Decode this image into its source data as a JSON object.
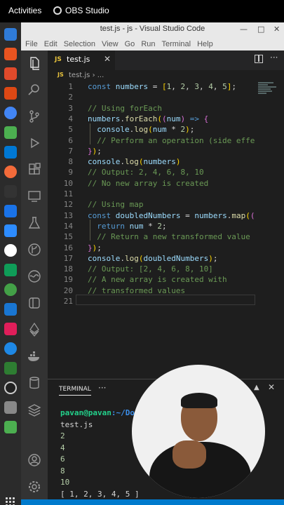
{
  "system": {
    "activities": "Activities",
    "app_name": "OBS Studio"
  },
  "window": {
    "title": "test.js - js - Visual Studio Code",
    "minimize": "—",
    "maximize": "□",
    "close": "✕"
  },
  "menu": [
    "File",
    "Edit",
    "Selection",
    "View",
    "Go",
    "Run",
    "Terminal",
    "Help"
  ],
  "tab": {
    "icon_label": "JS",
    "name": "test.js",
    "close": "✕"
  },
  "breadcrumb": {
    "icon_label": "JS",
    "file": "test.js",
    "sep": "› ..."
  },
  "editor": {
    "lines": [
      {
        "n": "1",
        "t": "const numbers = [1, 2, 3, 4, 5];"
      },
      {
        "n": "2",
        "t": ""
      },
      {
        "n": "3",
        "t": "// Using forEach"
      },
      {
        "n": "4",
        "t": "numbers.forEach((num) => {"
      },
      {
        "n": "5",
        "t": "  console.log(num * 2);"
      },
      {
        "n": "6",
        "t": "  // Perform an operation (side effe"
      },
      {
        "n": "7",
        "t": "});"
      },
      {
        "n": "8",
        "t": "console.log(numbers)"
      },
      {
        "n": "9",
        "t": "// Output: 2, 4, 6, 8, 10"
      },
      {
        "n": "10",
        "t": "// No new array is created"
      },
      {
        "n": "11",
        "t": ""
      },
      {
        "n": "12",
        "t": "// Using map"
      },
      {
        "n": "13",
        "t": "const doubledNumbers = numbers.map(("
      },
      {
        "n": "14",
        "t": "  return num * 2;"
      },
      {
        "n": "15",
        "t": "  // Return a new transformed value"
      },
      {
        "n": "16",
        "t": "});"
      },
      {
        "n": "17",
        "t": "console.log(doubledNumbers);"
      },
      {
        "n": "18",
        "t": "// Output: [2, 4, 6, 8, 10]"
      },
      {
        "n": "19",
        "t": "// A new array is created with"
      },
      {
        "n": "20",
        "t": "// transformed values"
      },
      {
        "n": "21",
        "t": ""
      }
    ]
  },
  "panel": {
    "tab": "TERMINAL",
    "more": "···"
  },
  "terminal": {
    "prompt_user": "pavan@pavan",
    "prompt_path": ":~/Do",
    "lines": [
      "test.js",
      "2",
      "4",
      "6",
      "8",
      "10",
      "[ 1, 2, 3, 4, 5 ]"
    ]
  },
  "colors": {
    "accent": "#007acc",
    "js_icon": "#e8c33c",
    "prompt": "#23d18b"
  }
}
